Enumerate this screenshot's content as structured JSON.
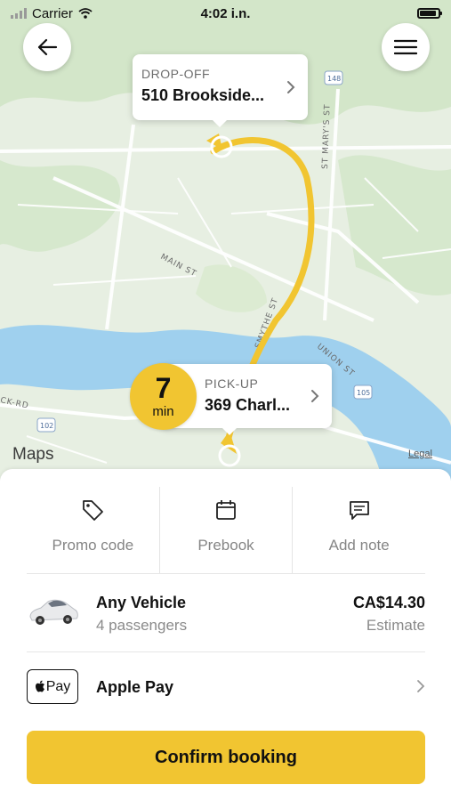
{
  "status": {
    "carrier": "Carrier",
    "time": "4:02 i.n."
  },
  "map": {
    "dropoff": {
      "label": "DROP-OFF",
      "address": "510 Brookside..."
    },
    "pickup": {
      "label": "PICK-UP",
      "address": "369 Charl..."
    },
    "eta": {
      "value": "7",
      "unit": "min"
    },
    "logo": "Maps",
    "legal": "Legal",
    "street_labels": [
      "MAIN ST",
      "SMYTHE ST",
      "UNION ST",
      "ST MARY'S ST",
      "CK-RD"
    ],
    "route_shields": [
      "148",
      "105",
      "102"
    ],
    "route_color": "#f1c531"
  },
  "actions": [
    {
      "label": "Promo code",
      "icon": "tag-icon"
    },
    {
      "label": "Prebook",
      "icon": "calendar-icon"
    },
    {
      "label": "Add note",
      "icon": "note-icon"
    }
  ],
  "vehicle": {
    "name": "Any Vehicle",
    "passengers": "4 passengers",
    "price": "CA$14.30",
    "price_note": "Estimate"
  },
  "payment": {
    "badge": "Pay",
    "name": "Apple Pay"
  },
  "confirm_label": "Confirm booking",
  "colors": {
    "accent": "#f1c531",
    "water": "#9fd0ee",
    "map_green": "#d3e6c9"
  }
}
